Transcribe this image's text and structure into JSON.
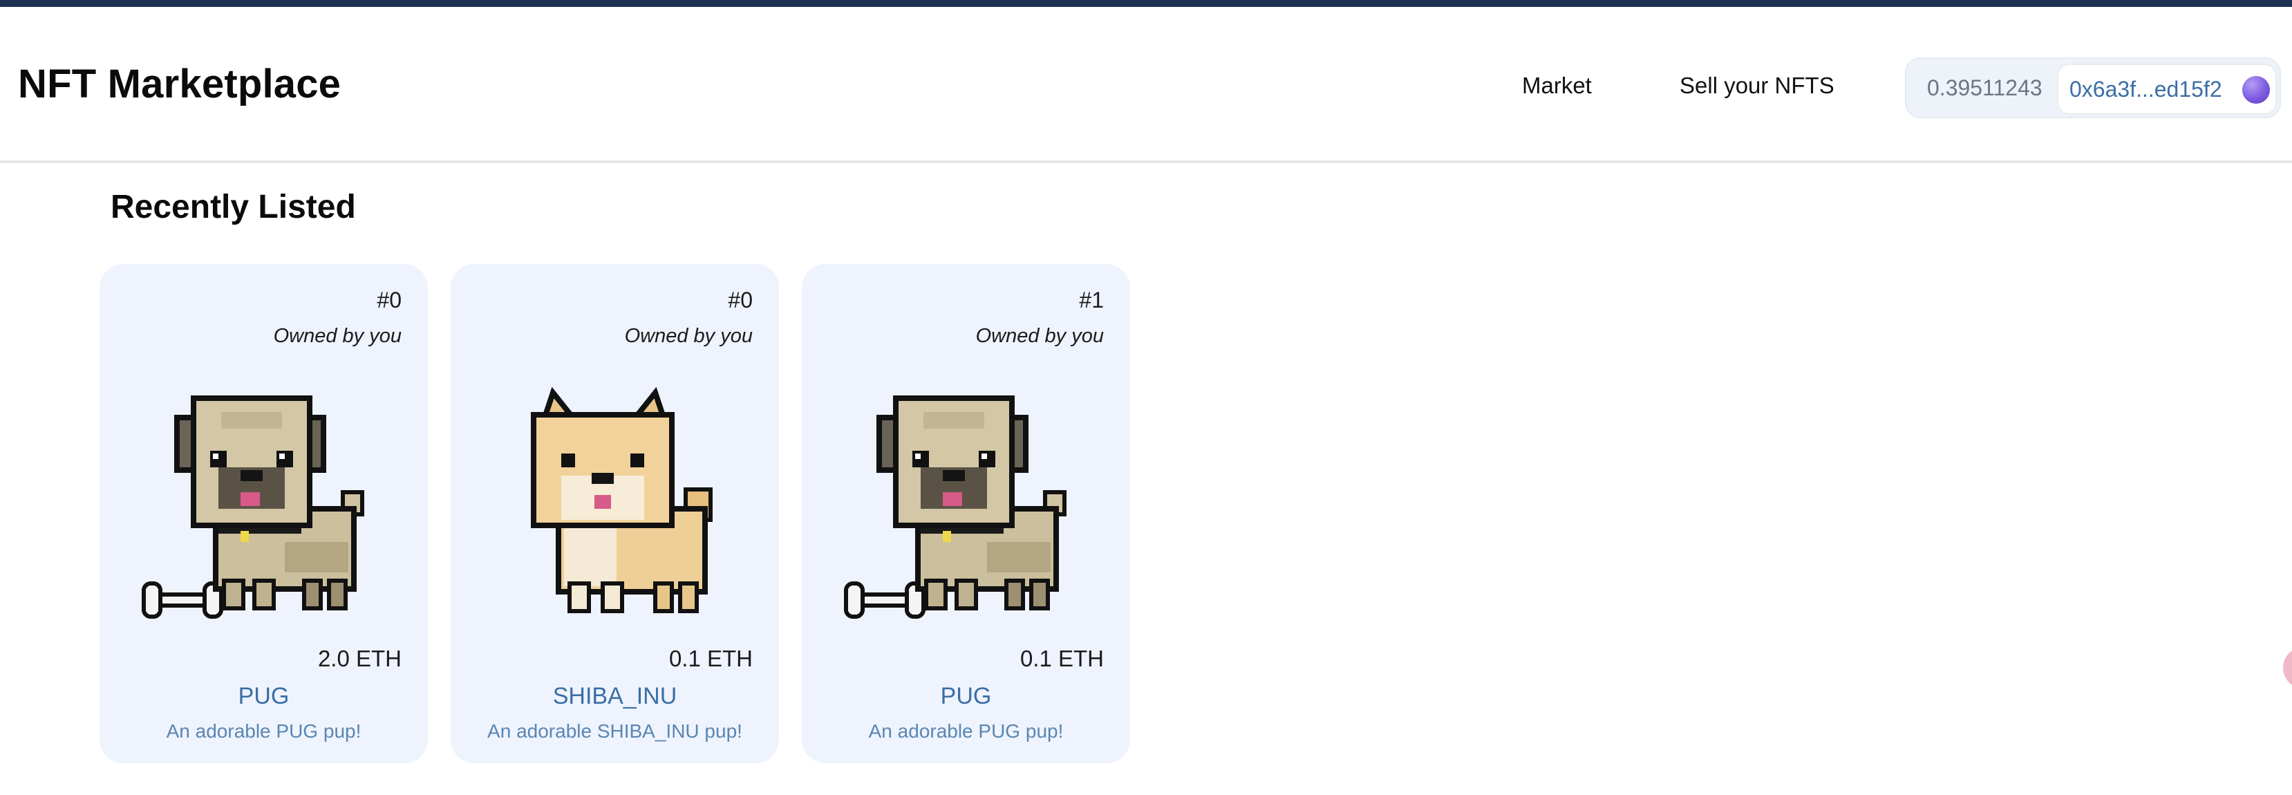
{
  "app": {
    "title": "NFT Marketplace"
  },
  "nav": {
    "market_label": "Market",
    "sell_label": "Sell your NFTS"
  },
  "wallet": {
    "balance": "0.39511243",
    "address": "0x6a3f...ed15f2"
  },
  "section": {
    "title": "Recently Listed"
  },
  "cards": [
    {
      "id": "#0",
      "owner": "Owned by you",
      "price": "2.0 ETH",
      "name": "PUG",
      "description": "An adorable PUG pup!",
      "image": "pug-pixel-art"
    },
    {
      "id": "#0",
      "owner": "Owned by you",
      "price": "0.1 ETH",
      "name": "SHIBA_INU",
      "description": "An adorable SHIBA_INU pup!",
      "image": "shiba-inu-pixel-art"
    },
    {
      "id": "#1",
      "owner": "Owned by you",
      "price": "0.1 ETH",
      "name": "PUG",
      "description": "An adorable PUG pup!",
      "image": "pug-pixel-art"
    }
  ],
  "colors": {
    "topbar": "#1e3150",
    "card_background": "#eef3fd",
    "link_blue": "#3b6ea5"
  }
}
